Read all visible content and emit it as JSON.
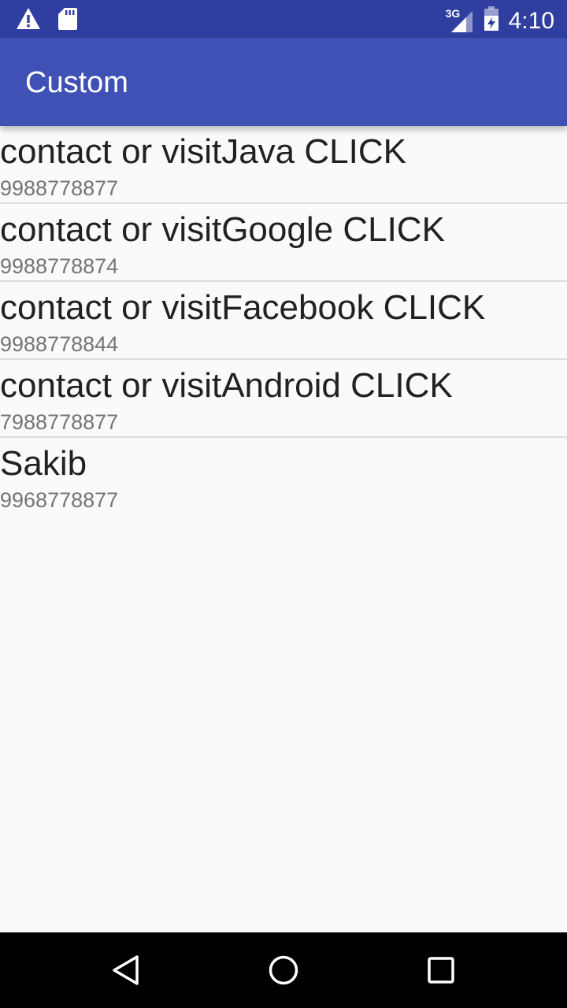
{
  "status_bar": {
    "time": "4:10",
    "network": "3G",
    "icons": [
      "warning-icon",
      "sd-card-icon",
      "signal-icon",
      "battery-icon"
    ]
  },
  "app_bar": {
    "title": "Custom",
    "color": "#3f51b5",
    "status_color": "#303f9f"
  },
  "list": {
    "items": [
      {
        "title": "contact or visitJava CLICK",
        "phone": "9988778877"
      },
      {
        "title": "contact or visitGoogle CLICK",
        "phone": "9988778874"
      },
      {
        "title": "contact or visitFacebook CLICK",
        "phone": "9988778844"
      },
      {
        "title": "contact or visitAndroid CLICK",
        "phone": "7988778877"
      },
      {
        "title": "Sakib",
        "phone": "9968778877"
      }
    ]
  },
  "nav_bar": {
    "icons": [
      "back-icon",
      "home-icon",
      "recents-icon"
    ]
  }
}
